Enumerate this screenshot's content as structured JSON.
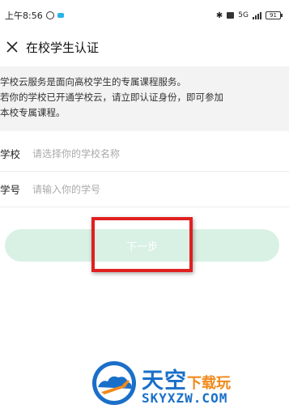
{
  "status_bar": {
    "time": "上午8:56",
    "network": "5G",
    "battery": "91"
  },
  "nav": {
    "title": "在校学生认证"
  },
  "notice": {
    "line1": "学校云服务是面向高校学生的专属课程服务。",
    "line2": "若你的学校已开通学校云，请立即认证身份，即可参加",
    "line3": "本校专属课程。"
  },
  "form": {
    "school_label": "学校",
    "school_placeholder": "请选择你的学校名称",
    "id_label": "学号",
    "id_placeholder": "请输入你的学号"
  },
  "next_button": {
    "label": "下一步"
  },
  "watermark": {
    "title_main": "天空",
    "title_sub": "下载玩",
    "domain": "SKYXZW.COM"
  },
  "colors": {
    "button_bg": "#d8f1e4",
    "highlight": "#e02020",
    "watermark_blue": "#1a6fc9",
    "watermark_orange": "#f08a1c"
  }
}
